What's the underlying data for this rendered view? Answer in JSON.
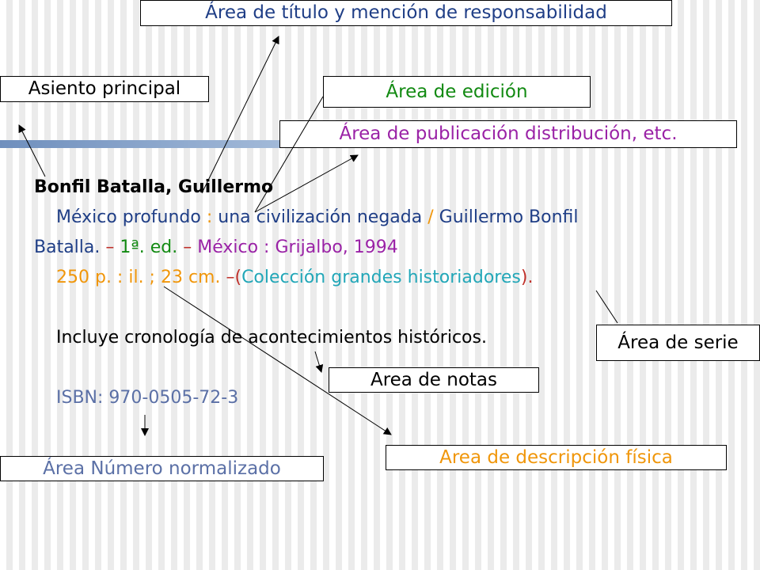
{
  "labels": {
    "titulo": "Área de título y mención de responsabilidad",
    "asiento": "Asiento principal",
    "edicion": "Área de edición",
    "publicacion": "Área de publicación distribución, etc.",
    "serie": "Área de serie",
    "notas": "Area de notas",
    "descripcion": "Area de descripción física",
    "numero": "Área Número normalizado"
  },
  "record": {
    "author": "Bonfil Batalla, Guillermo",
    "title": "México profundo",
    "sep1": ":",
    "subtitle": "una civilización negada",
    "sep2": "/",
    "responsibility_a": "Guillermo Bonfil",
    "responsibility_b": "Batalla.",
    "dash1": "–",
    "edition": "1ª. ed.",
    "dash2": "–",
    "publication": "México : Grijalbo, 1994",
    "physical": "250 p. : il. ; 23 cm.",
    "dash3": "–",
    "paren_open": "(",
    "series": "Colección grandes historiadores",
    "paren_close": ").",
    "note": "Incluye cronología de acontecimientos históricos.",
    "isbn": "ISBN: 970-0505-72-3"
  },
  "colors": {
    "titulo": "#1f3e86",
    "asiento": "#000000",
    "edicion": "#128a12",
    "publicacion": "#9a22a6",
    "serie": "#000000",
    "notas": "#000000",
    "descripcion": "#f0960a",
    "numero": "#5b70a6",
    "series_text": "#22a7b8"
  }
}
